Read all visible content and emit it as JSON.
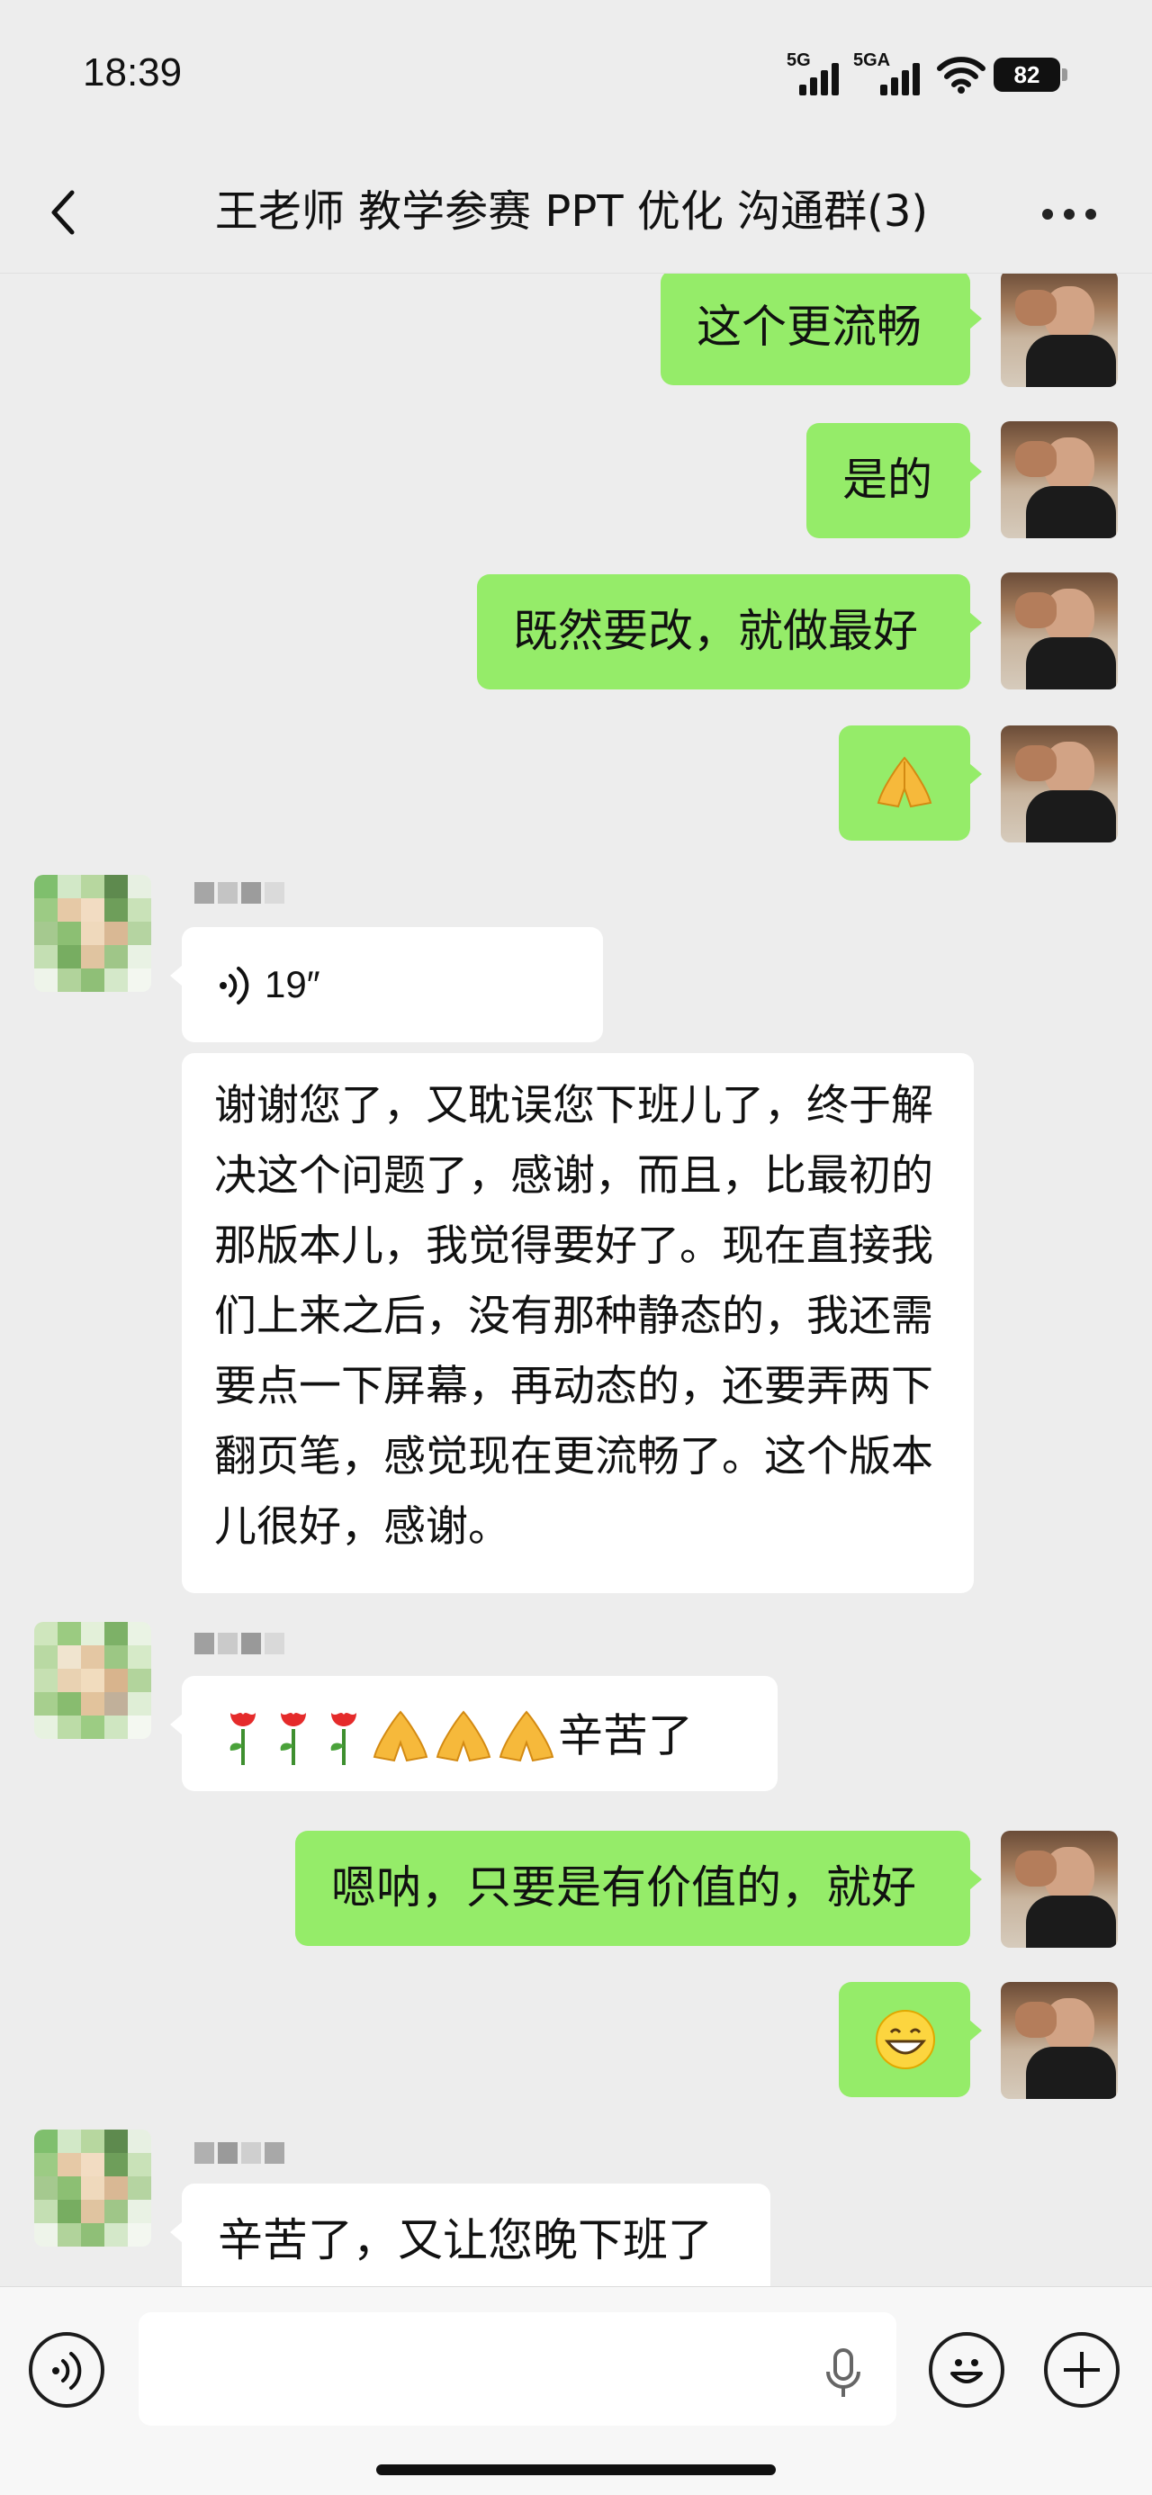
{
  "status_bar": {
    "time": "18:39",
    "signal1_label": "5G",
    "signal2_label": "5GA",
    "battery": "82"
  },
  "nav": {
    "title": "王老师 教学参赛 PPT 优化 沟通群(3)"
  },
  "messages": [
    {
      "side": "me",
      "type": "text",
      "text": "这个更流畅"
    },
    {
      "side": "me",
      "type": "text",
      "text": "是的"
    },
    {
      "side": "me",
      "type": "text",
      "text": "既然要改，就做最好"
    },
    {
      "side": "me",
      "type": "emoji",
      "icon": "pressed-hands-emoji"
    },
    {
      "side": "other",
      "type": "voice",
      "duration": "19″"
    },
    {
      "side": "other",
      "type": "text",
      "text": "谢谢您了，又耽误您下班儿了，终于解决这个问题了，感谢，而且，比最初的那版本儿，我觉得要好了。现在直接我们上来之后，没有那种静态的，我还需要点一下屏幕，再动态的，还要弄两下翻页笔，感觉现在更流畅了。这个版本儿很好，感谢。"
    },
    {
      "side": "other",
      "type": "text",
      "icons": [
        "rose-emoji",
        "rose-emoji",
        "rose-emoji",
        "pressed-hands-emoji",
        "pressed-hands-emoji",
        "pressed-hands-emoji"
      ],
      "text": "辛苦了"
    },
    {
      "side": "me",
      "type": "text",
      "text": "嗯呐，只要是有价值的，就好"
    },
    {
      "side": "me",
      "type": "emoji",
      "icon": "grinning-face-emoji"
    },
    {
      "side": "other",
      "type": "text",
      "text": "辛苦了，又让您晚下班了"
    }
  ],
  "colors": {
    "background": "#ededed",
    "my_bubble": "#95ec69",
    "other_bubble": "#ffffff"
  },
  "input_bar": {
    "voice_toggle_icon": "voice-toggle-icon",
    "mic_icon": "microphone-icon",
    "emoji_icon": "emoji-icon",
    "plus_icon": "plus-icon"
  }
}
